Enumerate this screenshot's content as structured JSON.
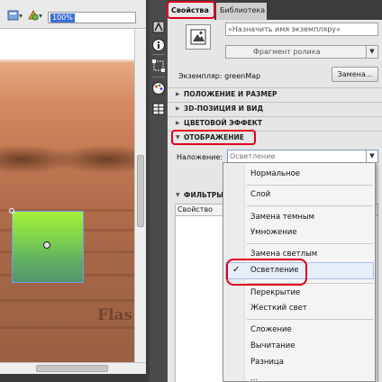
{
  "toolbar": {
    "zoom_value": "100%",
    "edit_scene_icon": "edit-scene-icon",
    "edit_symbol_icon": "edit-symbol-icon"
  },
  "stage": {
    "watermark": "Flas"
  },
  "panel": {
    "tabs": [
      {
        "label": "Свойства",
        "active": true
      },
      {
        "label": "Библиотека",
        "active": false
      }
    ],
    "instance_name_placeholder": "«Назначить имя экземпляру»",
    "symbol_type": "Фрагмент ролика",
    "instance_of_label": "Экземпляр:",
    "instance_of_value": "greenMap",
    "swap_button": "Замена...",
    "sections": [
      {
        "label": "ПОЛОЖЕНИЕ И РАЗМЕР",
        "expanded": false
      },
      {
        "label": "3D-ПОЗИЦИЯ И ВИД",
        "expanded": false
      },
      {
        "label": "ЦВЕТОВОЙ ЭФФЕКТ",
        "expanded": false
      },
      {
        "label": "ОТОБРАЖЕНИЕ",
        "expanded": true
      }
    ],
    "blend_label": "Наложение:",
    "blend_value": "Осветление",
    "side_text": "о",
    "filters_label": "ФИЛЬТРЫ",
    "filters_column": "Свойство"
  },
  "dropdown": {
    "items": [
      "Нормальное",
      "Слой",
      "Замена темным",
      "Умножение",
      "Замена светлым",
      "Осветление",
      "Перекрытие",
      "Жесткий свет",
      "Сложение",
      "Вычитание",
      "Разница",
      "..."
    ],
    "selected": "Осветление"
  },
  "colors": {
    "highlight": "#e0001b",
    "symbol_green": "#7ce24a",
    "panel_bg": "#e6e6e6",
    "dark_chrome": "#3c3c3c"
  }
}
